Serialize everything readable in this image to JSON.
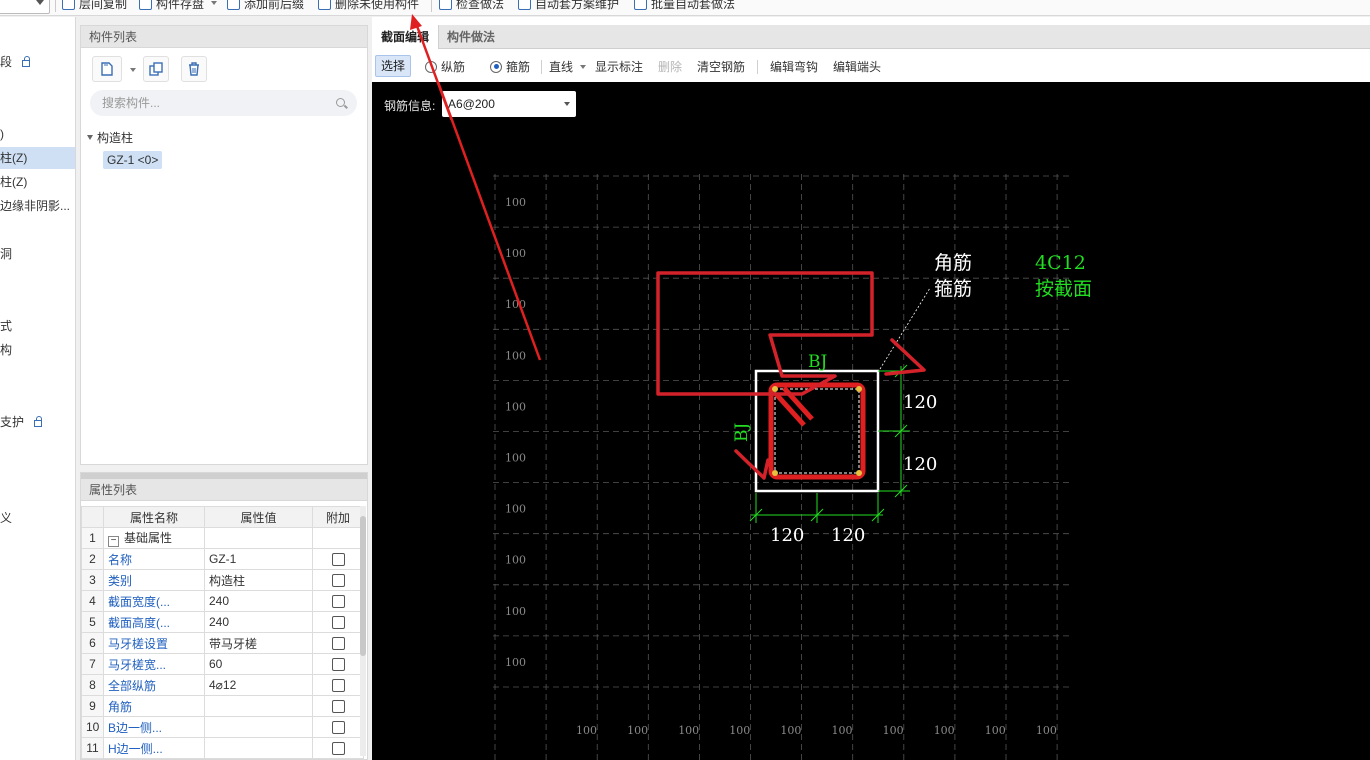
{
  "toolbar": {
    "items": [
      "层间复制",
      "构件存盘",
      "添加前后缀",
      "删除未使用构件",
      "检查做法",
      "自动套方案维护",
      "批量自动套做法"
    ]
  },
  "left_nav": {
    "items": [
      {
        "label": "段",
        "locked": true
      },
      {
        "label": ")",
        "locked": false
      },
      {
        "label": "柱(Z)",
        "locked": false,
        "selected": true
      },
      {
        "label": "柱(Z)",
        "locked": false
      },
      {
        "label": "边缘非阴影...",
        "locked": false
      },
      {
        "label": "洞",
        "locked": false
      },
      {
        "label": "式",
        "locked": false
      },
      {
        "label": "构",
        "locked": false
      },
      {
        "label": "支护",
        "locked": true
      },
      {
        "label": "义",
        "locked": false
      }
    ]
  },
  "component_list": {
    "title": "构件列表",
    "search_placeholder": "搜索构件...",
    "tree_root": "构造柱",
    "tree_child": "GZ-1 <0>"
  },
  "property_list": {
    "title": "属性列表",
    "columns": [
      "属性名称",
      "属性值",
      "附加"
    ],
    "rows": [
      {
        "num": "1",
        "name": "基础属性",
        "value": "",
        "group": true
      },
      {
        "num": "2",
        "name": "名称",
        "value": "GZ-1",
        "check": false
      },
      {
        "num": "3",
        "name": "类别",
        "value": "构造柱",
        "check": true
      },
      {
        "num": "4",
        "name": "截面宽度(...",
        "value": "240",
        "check": true
      },
      {
        "num": "5",
        "name": "截面高度(...",
        "value": "240",
        "check": true
      },
      {
        "num": "6",
        "name": "马牙槎设置",
        "value": "带马牙槎",
        "check": true
      },
      {
        "num": "7",
        "name": "马牙槎宽...",
        "value": "60",
        "check": true
      },
      {
        "num": "8",
        "name": "全部纵筋",
        "value": "4⌀12",
        "check": true
      },
      {
        "num": "9",
        "name": "角筋",
        "value": "",
        "check": true
      },
      {
        "num": "10",
        "name": "B边一侧...",
        "value": "",
        "check": true
      },
      {
        "num": "11",
        "name": "H边一侧...",
        "value": "",
        "check": true
      }
    ]
  },
  "editor": {
    "tabs": [
      "截面编辑",
      "构件做法"
    ],
    "toolbar": {
      "select": "选择",
      "longitudinal": "纵筋",
      "stirrup": "箍筋",
      "line": "直线",
      "show_dim": "显示标注",
      "delete": "删除",
      "clear": "清空钢筋",
      "edit_hook": "编辑弯钩",
      "edit_end": "编辑端头"
    },
    "rebar_info_label": "钢筋信息:",
    "rebar_info_value": "A6@200"
  },
  "drawing": {
    "grid_label": "100",
    "corner_label": "角筋",
    "stirrup_label": "箍筋",
    "corner_value": "4C12",
    "stirrup_value": "按截面",
    "bj_label": "BJ",
    "dims": [
      "120",
      "120",
      "120",
      "120"
    ]
  },
  "colors": {
    "accent_blue": "#1f5fbf",
    "selection": "#cfe0f5",
    "rebar_green": "#22dd22",
    "annotation_red": "#e02020",
    "canvas_bg": "#000000"
  }
}
